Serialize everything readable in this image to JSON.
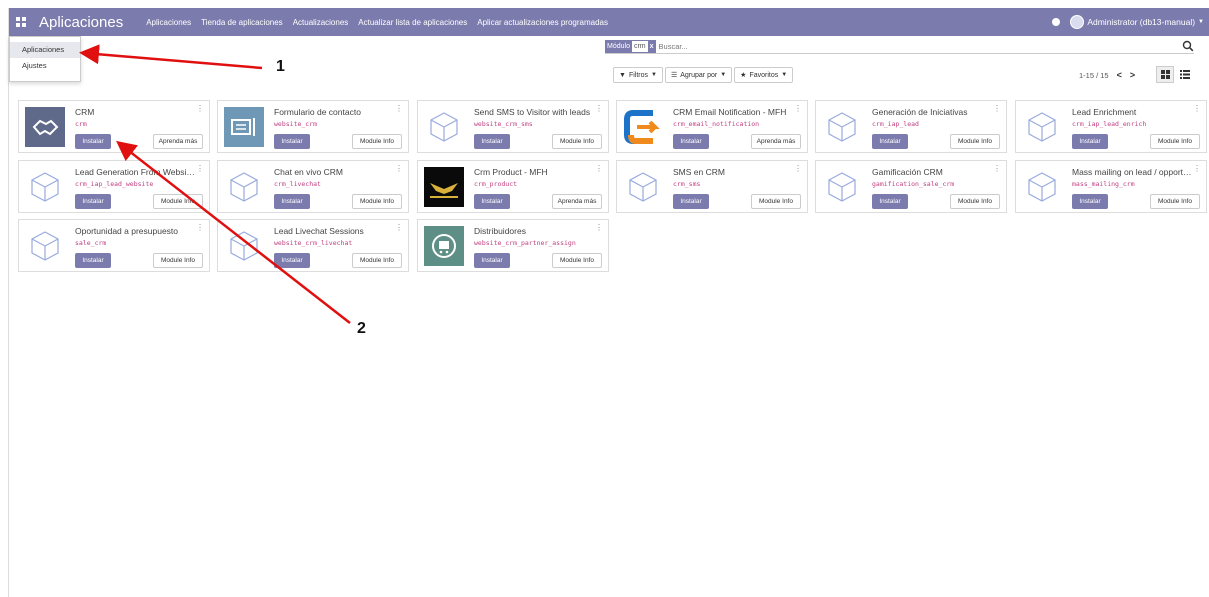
{
  "navbar": {
    "brand": "Aplicaciones",
    "menu": [
      "Aplicaciones",
      "Tienda de aplicaciones",
      "Actualizaciones",
      "Actualizar lista de aplicaciones",
      "Aplicar actualizaciones programadas"
    ],
    "user": "Administrator (db13-manual)",
    "bg_color": "#7c7bad"
  },
  "dropdown": {
    "items": [
      "Aplicaciones",
      "Ajustes"
    ]
  },
  "search": {
    "facet_label": "Módulo",
    "facet_value": "crm",
    "facet_remove": "x",
    "placeholder": "Buscar..."
  },
  "filters": {
    "filters_label": "Filtros",
    "group_label": "Agrupar por",
    "favorites_label": "Favoritos"
  },
  "pager": {
    "value": "1-15 / 15",
    "prev": "<",
    "next": ">"
  },
  "cards": [
    {
      "title": "CRM",
      "tech": "crm",
      "install": "Instalar",
      "action": "Aprenda más",
      "icon": "crm-handshake-icon"
    },
    {
      "title": "Formulario de contacto",
      "tech": "website_crm",
      "install": "Instalar",
      "action": "Module Info",
      "icon": "contact-form-icon"
    },
    {
      "title": "Send SMS to Visitor with leads",
      "tech": "website_crm_sms",
      "install": "Instalar",
      "action": "Module Info",
      "icon": "cube-icon"
    },
    {
      "title": "CRM Email Notification - MFH",
      "tech": "crm_email_notification",
      "install": "Instalar",
      "action": "Aprenda más",
      "icon": "email-notification-icon"
    },
    {
      "title": "Generación de Iniciativas",
      "tech": "crm_iap_lead",
      "install": "Instalar",
      "action": "Module Info",
      "icon": "cube-icon"
    },
    {
      "title": "Lead Enrichment",
      "tech": "crm_iap_lead_enrich",
      "install": "Instalar",
      "action": "Module Info",
      "icon": "cube-icon"
    },
    {
      "title": "Lead Generation From Websi…",
      "tech": "crm_iap_lead_website",
      "install": "Instalar",
      "action": "Module Info",
      "icon": "cube-icon"
    },
    {
      "title": "Chat en vivo CRM",
      "tech": "crm_livechat",
      "install": "Instalar",
      "action": "Module Info",
      "icon": "cube-icon"
    },
    {
      "title": "Crm Product - MFH",
      "tech": "crm_product",
      "install": "Instalar",
      "action": "Aprenda más",
      "icon": "product-logo-icon"
    },
    {
      "title": "SMS en CRM",
      "tech": "crm_sms",
      "install": "Instalar",
      "action": "Module Info",
      "icon": "cube-icon"
    },
    {
      "title": "Gamificación CRM",
      "tech": "gamification_sale_crm",
      "install": "Instalar",
      "action": "Module Info",
      "icon": "cube-icon"
    },
    {
      "title": "Mass mailing on lead / opport…",
      "tech": "mass_mailing_crm",
      "install": "Instalar",
      "action": "Module Info",
      "icon": "cube-icon"
    },
    {
      "title": "Oportunidad a presupuesto",
      "tech": "sale_crm",
      "install": "Instalar",
      "action": "Module Info",
      "icon": "cube-icon"
    },
    {
      "title": "Lead Livechat Sessions",
      "tech": "website_crm_livechat",
      "install": "Instalar",
      "action": "Module Info",
      "icon": "cube-icon"
    },
    {
      "title": "Distribuidores",
      "tech": "website_crm_partner_assign",
      "install": "Instalar",
      "action": "Module Info",
      "icon": "distributor-cart-icon"
    }
  ],
  "annotations": {
    "label_1": "1",
    "label_2": "2",
    "arrow_color": "#e01010"
  }
}
